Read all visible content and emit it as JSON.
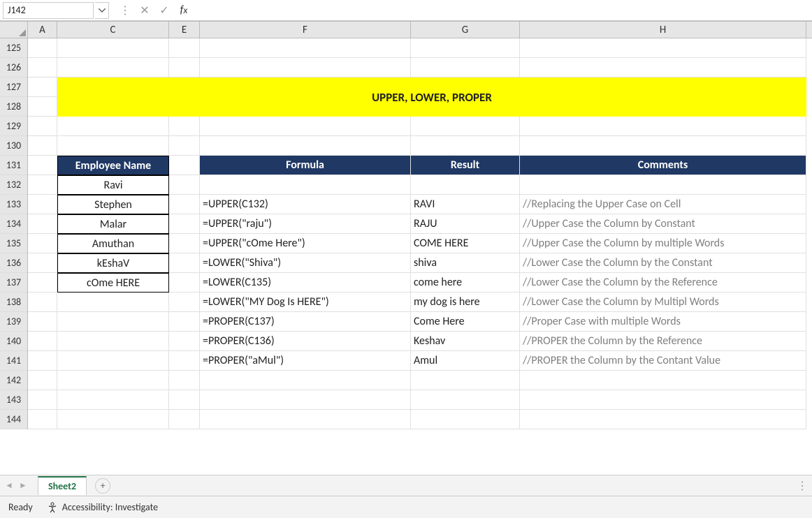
{
  "nameBox": "J142",
  "formulaInput": "",
  "columns": [
    "A",
    "C",
    "E",
    "F",
    "G",
    "H"
  ],
  "rowNumbers": [
    "125",
    "126",
    "127",
    "128",
    "129",
    "130",
    "131",
    "132",
    "133",
    "134",
    "135",
    "136",
    "137",
    "138",
    "139",
    "140",
    "141",
    "142",
    "143",
    "144"
  ],
  "banner": "UPPER, LOWER, PROPER",
  "headers": {
    "employee": "Employee Name",
    "formula": "Formula",
    "result": "Result",
    "comments": "Comments"
  },
  "employees": [
    "Ravi",
    "Stephen",
    "Malar",
    "Amuthan",
    "kEshaV",
    "cOme HERE"
  ],
  "dataRows": [
    {
      "formula": "=UPPER(C132)",
      "result": "RAVI",
      "comment": "//Replacing the Upper Case on Cell"
    },
    {
      "formula": "=UPPER(\"raju\")",
      "result": "RAJU",
      "comment": "//Upper Case the Column by Constant"
    },
    {
      "formula": "=UPPER(\"cOme Here\")",
      "result": "COME HERE",
      "comment": "//Upper Case the Column by multiple Words"
    },
    {
      "formula": "=LOWER(\"Shiva\")",
      "result": "shiva",
      "comment": "//Lower Case the Column by the Constant"
    },
    {
      "formula": "=LOWER(C135)",
      "result": "come here",
      "comment": "//Lower Case the Column by the Reference"
    },
    {
      "formula": "=LOWER(\"MY Dog Is HERE\")",
      "result": "my dog is here",
      "comment": "//Lower Case the Column by Multipl Words"
    },
    {
      "formula": "=PROPER(C137)",
      "result": "Come Here",
      "comment": "//Proper Case with multiple Words"
    },
    {
      "formula": "=PROPER(C136)",
      "result": "Keshav",
      "comment": "//PROPER the Column by the Reference"
    },
    {
      "formula": "=PROPER(\"aMul\")",
      "result": "Amul",
      "comment": "//PROPER the Column by the Contant Value"
    }
  ],
  "sheetTab": "Sheet2",
  "status": {
    "ready": "Ready",
    "accessibility": "Accessibility: Investigate"
  }
}
